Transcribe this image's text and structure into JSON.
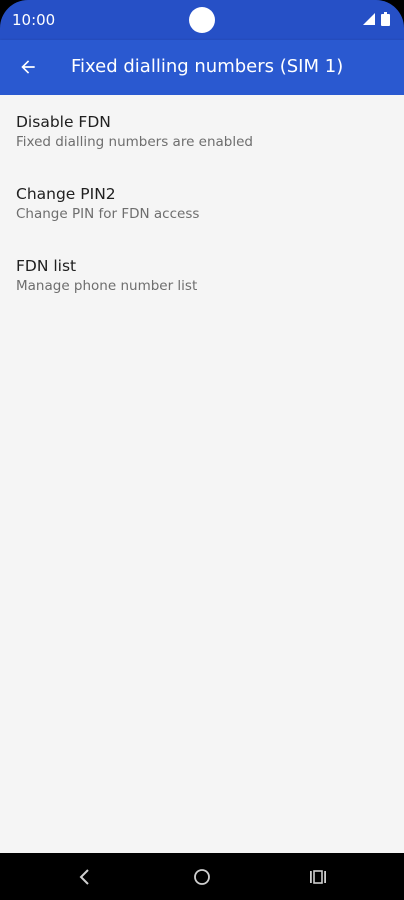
{
  "status_bar": {
    "time": "10:00",
    "icons": [
      "signal-icon",
      "battery-icon"
    ]
  },
  "app_bar": {
    "back_icon": "arrow-back-icon",
    "title": "Fixed dialling numbers (SIM 1)"
  },
  "preferences": [
    {
      "title": "Disable FDN",
      "summary": "Fixed dialling numbers are enabled"
    },
    {
      "title": "Change PIN2",
      "summary": "Change PIN for FDN access"
    },
    {
      "title": "FDN list",
      "summary": "Manage phone number list"
    }
  ],
  "nav_bar": {
    "icons": [
      "back-nav-icon",
      "home-nav-icon",
      "recents-nav-icon"
    ]
  },
  "colors": {
    "status_bar": "#2650c6",
    "app_bar": "#2a59d0",
    "background": "#f5f5f5",
    "title_text": "#202020",
    "summary_text": "#6e6e6e"
  }
}
